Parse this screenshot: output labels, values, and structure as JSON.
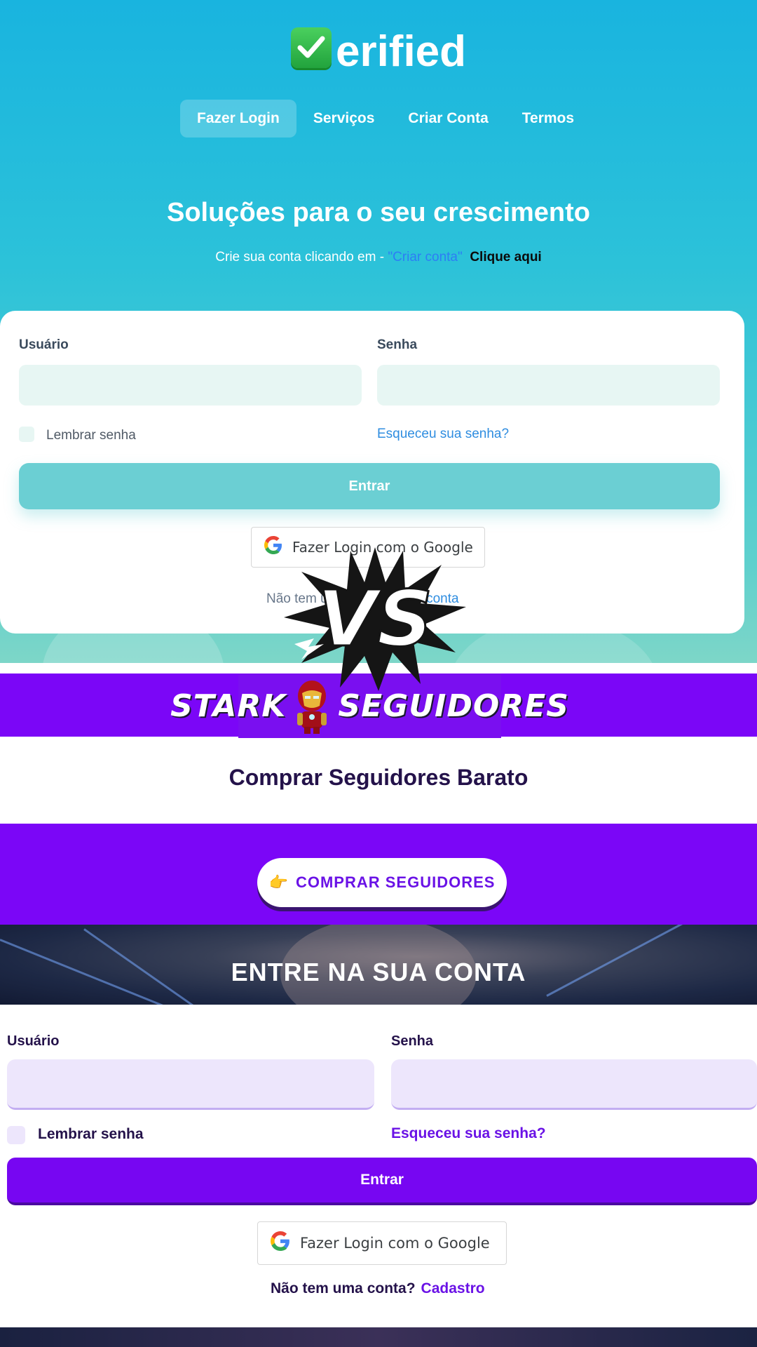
{
  "verified": {
    "brand_suffix": "erified",
    "nav": [
      {
        "label": "Fazer Login"
      },
      {
        "label": "Serviços"
      },
      {
        "label": "Criar Conta"
      },
      {
        "label": "Termos"
      }
    ],
    "hero_title": "Soluções para o seu crescimento",
    "hero_sub_prefix": "Crie sua conta clicando em - ",
    "hero_sub_link": "\"Criar conta\"",
    "hero_sub_cta": "Clique aqui",
    "form": {
      "user_label": "Usuário",
      "pass_label": "Senha",
      "user_value": "",
      "pass_value": "",
      "remember_label": "Lembrar senha",
      "forgot_label": "Esqueceu sua senha?",
      "enter_label": "Entrar",
      "google_label": "Fazer Login com o Google",
      "no_account_prefix": "Não tem uma conta?",
      "no_account_link": "Criar conta"
    },
    "colors": {
      "accent": "#6bcfd3",
      "header": "#19b4df"
    }
  },
  "vs_label": "VS",
  "stark": {
    "logo_left": "STARK",
    "logo_right": "SEGUIDORES",
    "title": "Comprar Seguidores Barato",
    "buy_button_icon": "👉",
    "buy_button_label": "COMPRAR SEGUIDORES",
    "login_title": "ENTRE NA SUA CONTA",
    "form": {
      "user_label": "Usuário",
      "pass_label": "Senha",
      "user_value": "",
      "pass_value": "",
      "remember_label": "Lembrar senha",
      "forgot_label": "Esqueceu sua senha?",
      "enter_label": "Entrar",
      "google_label": "Fazer Login com o Google",
      "no_account_prefix": "Não tem uma conta?",
      "no_account_link": "Cadastro"
    },
    "colors": {
      "accent": "#7b06f7"
    }
  }
}
